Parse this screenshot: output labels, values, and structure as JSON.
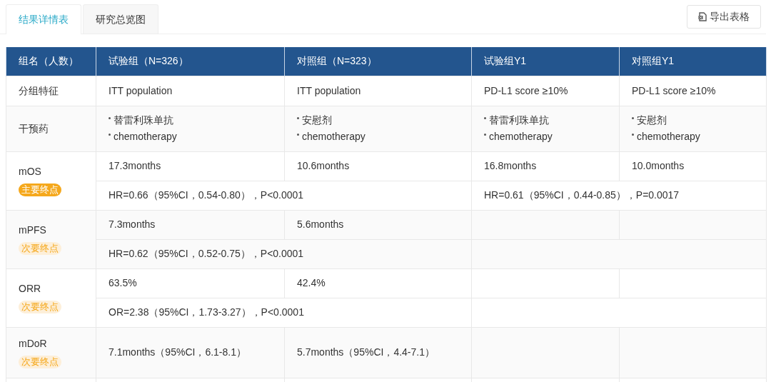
{
  "tabs": [
    {
      "label": "结果详情表",
      "selected": true
    },
    {
      "label": "研究总览图",
      "selected": false
    }
  ],
  "export_button": {
    "label": "导出表格"
  },
  "table": {
    "columns": [
      "组名（人数）",
      "试验组（N=326）",
      "对照组（N=323）",
      "试验组Y1",
      "对照组Y1"
    ],
    "rows": [
      {
        "kind": "text",
        "label": "分组特征",
        "cells": [
          "ITT population",
          "ITT population",
          "PD-L1 score ≥10%",
          "PD-L1 score ≥10%"
        ]
      },
      {
        "kind": "bullets",
        "label": "干预药",
        "cells": [
          [
            "替雷利珠单抗",
            "chemotherapy"
          ],
          [
            "安慰剂",
            "chemotherapy"
          ],
          [
            "替雷利珠单抗",
            "chemotherapy"
          ],
          [
            "安慰剂",
            "chemotherapy"
          ]
        ]
      },
      {
        "kind": "endpoint",
        "label": "mOS",
        "badge": {
          "text": "主要终点",
          "primary": true
        },
        "values": [
          "17.3months",
          "10.6months",
          "16.8months",
          "10.0months"
        ],
        "stats": [
          "HR=0.66（95%CI，0.54-0.80），P<0.0001",
          "HR=0.61（95%CI，0.44-0.85），P=0.0017"
        ]
      },
      {
        "kind": "endpoint",
        "label": "mPFS",
        "badge": {
          "text": "次要终点",
          "primary": false
        },
        "values": [
          "7.3months",
          "5.6months"
        ],
        "stats": [
          "HR=0.62（95%CI，0.52-0.75），P<0.0001"
        ]
      },
      {
        "kind": "endpoint",
        "label": "ORR",
        "badge": {
          "text": "次要终点",
          "primary": false
        },
        "values": [
          "63.5%",
          "42.4%"
        ],
        "stats": [
          "OR=2.38（95%CI，1.73-3.27），P<0.0001"
        ]
      },
      {
        "kind": "single",
        "label": "mDoR",
        "badge": {
          "text": "次要终点",
          "primary": false
        },
        "values": [
          "7.1months（95%CI，6.1-8.1）",
          "5.7months（95%CI，4.4-7.1）"
        ]
      }
    ]
  }
}
